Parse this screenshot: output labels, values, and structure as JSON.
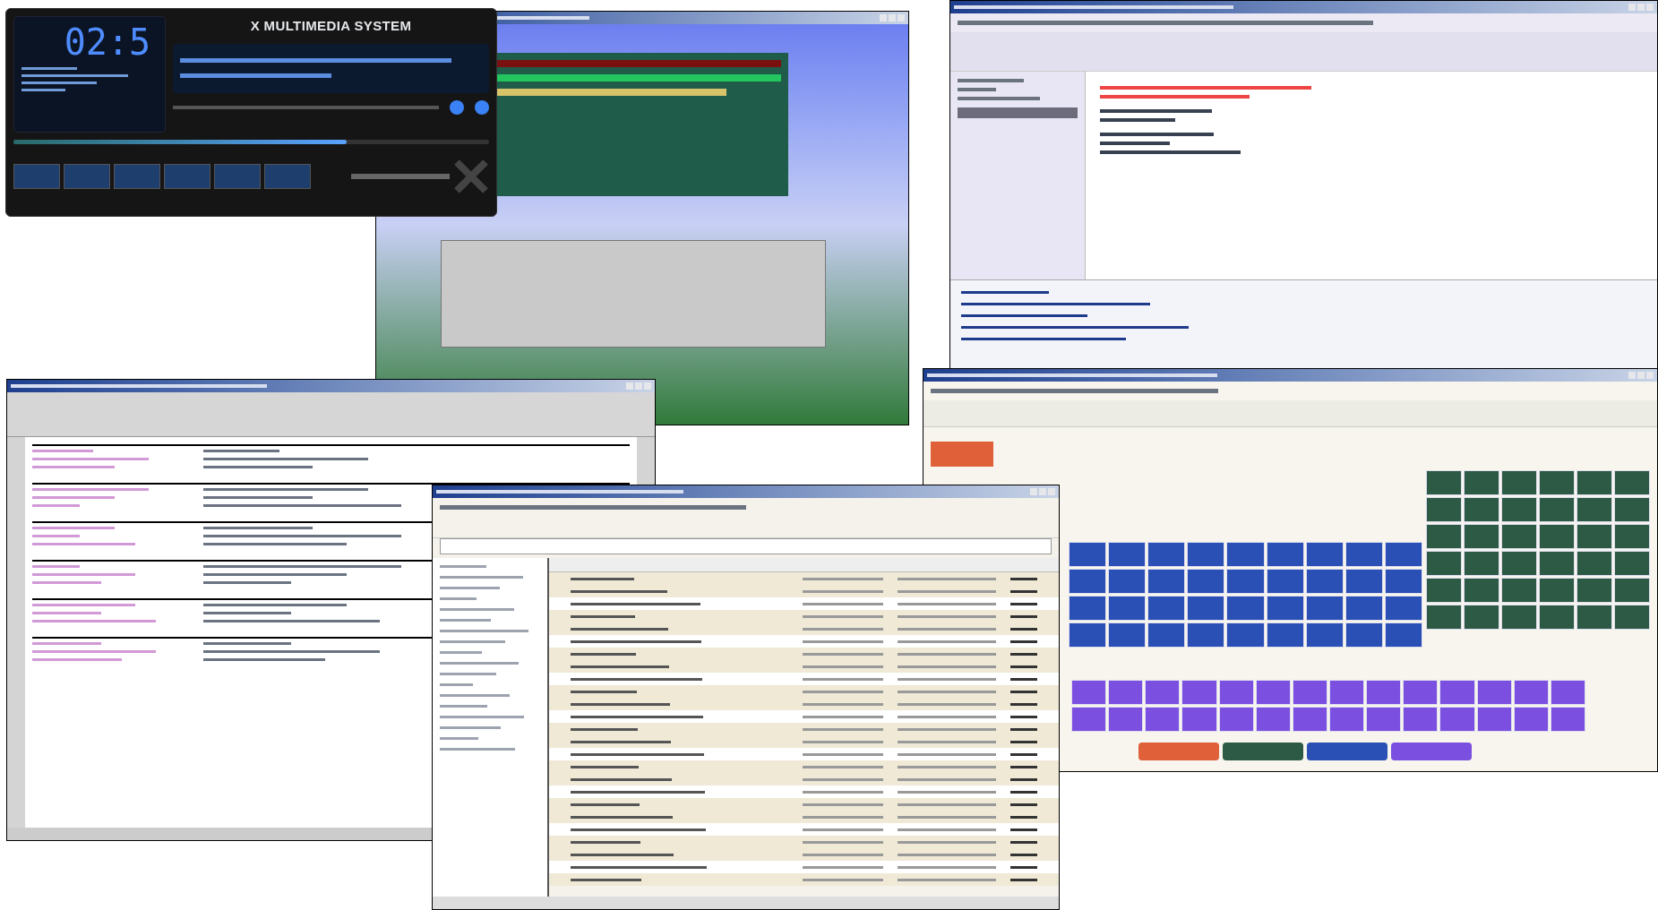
{
  "player": {
    "title": "X MULTIMEDIA SYSTEM",
    "time": "02:5",
    "seek": {
      "level": 0.7
    }
  }
}
